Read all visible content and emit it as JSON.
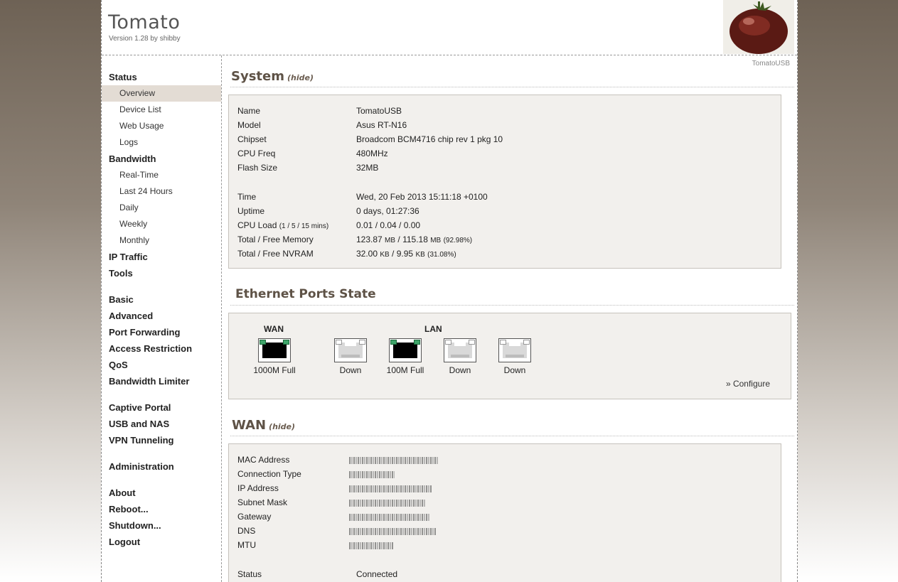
{
  "header": {
    "title": "Tomato",
    "version": "Version 1.28 by shibby"
  },
  "site_name": "TomatoUSB",
  "nav": {
    "status": "Status",
    "overview": "Overview",
    "device_list": "Device List",
    "web_usage": "Web Usage",
    "logs": "Logs",
    "bandwidth": "Bandwidth",
    "real_time": "Real-Time",
    "last24": "Last 24 Hours",
    "daily": "Daily",
    "weekly": "Weekly",
    "monthly": "Monthly",
    "ip_traffic": "IP Traffic",
    "tools": "Tools",
    "basic": "Basic",
    "advanced": "Advanced",
    "port_forwarding": "Port Forwarding",
    "access_restriction": "Access Restriction",
    "qos": "QoS",
    "bandwidth_limiter": "Bandwidth Limiter",
    "captive_portal": "Captive Portal",
    "usb_nas": "USB and NAS",
    "vpn": "VPN Tunneling",
    "administration": "Administration",
    "about": "About",
    "reboot": "Reboot...",
    "shutdown": "Shutdown...",
    "logout": "Logout"
  },
  "system": {
    "title": "System",
    "hide": "(hide)",
    "name_k": "Name",
    "name_v": "TomatoUSB",
    "model_k": "Model",
    "model_v": "Asus RT-N16",
    "chipset_k": "Chipset",
    "chipset_v": "Broadcom BCM4716 chip rev 1 pkg 10",
    "cpufreq_k": "CPU Freq",
    "cpufreq_v": "480MHz",
    "flash_k": "Flash Size",
    "flash_v": "32MB",
    "time_k": "Time",
    "time_v": "Wed, 20 Feb 2013 15:11:18 +0100",
    "uptime_k": "Uptime",
    "uptime_v": "0 days, 01:27:36",
    "cpuload_k": "CPU Load",
    "cpuload_k_small": "(1 / 5 / 15 mins)",
    "cpuload_v": "0.01 / 0.04 / 0.00",
    "mem_k": "Total / Free Memory",
    "mem_total": "123.87",
    "mem_free": "115.18",
    "mem_unit": "MB",
    "mem_pct": "(92.98%)",
    "nvram_k": "Total / Free NVRAM",
    "nvram_total": "32.00",
    "nvram_free": "9.95",
    "nvram_unit": "KB",
    "nvram_pct": "(31.08%)"
  },
  "ethernet": {
    "title": "Ethernet Ports State",
    "wan_head": "WAN",
    "lan_head": "LAN",
    "ports": [
      "1000M Full",
      "Down",
      "100M Full",
      "Down",
      "Down"
    ],
    "configure": "» Configure"
  },
  "wan": {
    "title": "WAN",
    "hide": "(hide)",
    "mac_k": "MAC Address",
    "conn_k": "Connection Type",
    "ip_k": "IP Address",
    "mask_k": "Subnet Mask",
    "gw_k": "Gateway",
    "dns_k": "DNS",
    "mtu_k": "MTU",
    "status_k": "Status",
    "status_v": "Connected"
  }
}
